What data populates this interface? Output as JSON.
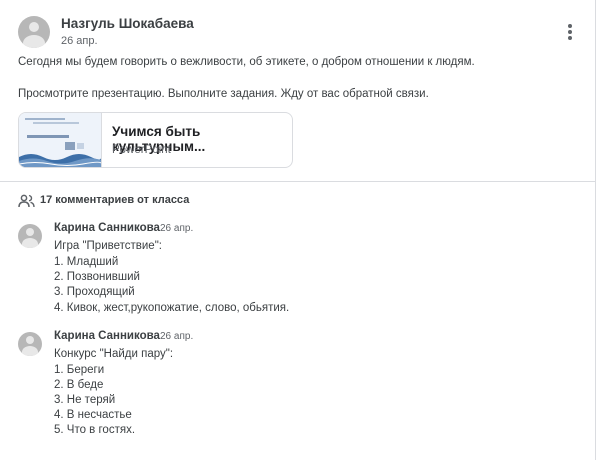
{
  "post": {
    "author": "Назгуль Шокабаева",
    "date": "26 апр.",
    "text1": "Сегодня мы будем говорить о вежливости, об этикете, о добром отношении к людям.",
    "text2": "Просмотрите презентацию. Выполните задания. Жду от вас обратной связи.",
    "more_icon": "more-vert-icon"
  },
  "attachment": {
    "title": "Учимся быть культурным...",
    "type": "PowerPoint",
    "thumb_text": "«Учимся быть культурными»"
  },
  "comments_header": {
    "icon": "people-icon",
    "label": "17 комментариев от класса"
  },
  "comments": [
    {
      "author": "Карина Санникова",
      "date": "26 апр.",
      "lines": [
        "Игра \"Приветствие\":",
        "1. Младший",
        "2. Позвонивший",
        "3. Проходящий",
        "4. Кивок, жест,рукопожатие, слово, обьятия."
      ]
    },
    {
      "author": "Карина Санникова",
      "date": "26 апр.",
      "lines": [
        "Конкурс \"Найди пару\":",
        "1. Береги",
        "2. В беде",
        "3. Не теряй",
        "4. В несчастье",
        "5. Что в гостях."
      ]
    }
  ],
  "colors": {
    "text": "#3c4043",
    "secondary": "#5f6368",
    "border": "#dadce0",
    "avatar": "#b7b7b7"
  }
}
